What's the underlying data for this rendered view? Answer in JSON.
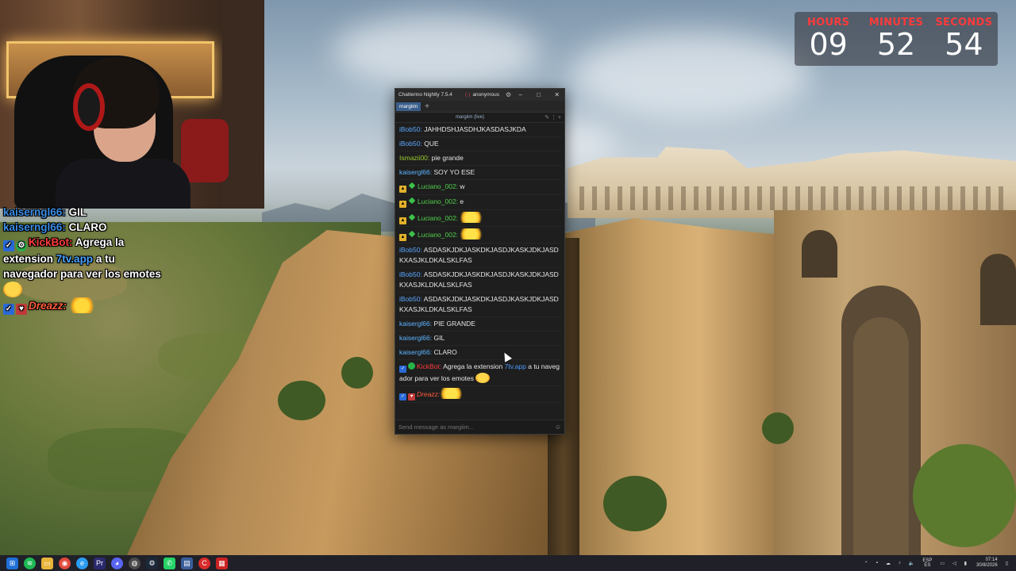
{
  "timer": {
    "hours_label": "HOURS",
    "hours": "09",
    "minutes_label": "MINUTES",
    "minutes": "52",
    "seconds_label": "SECONDS",
    "seconds": "54"
  },
  "overlay_chat": {
    "line1_user": "kaiserngl66:",
    "line1_text": "GIL",
    "line2_user": "kaiserngl66:",
    "line2_text": "CLARO",
    "line3_user": "KickBot:",
    "line3_text_a": "Agrega la extension",
    "line3_link": "7tv.app",
    "line3_text_b": "a tu navegador para ver los emotes",
    "line4_user": "Dreazz:"
  },
  "chatterino": {
    "title": "Chatterino Nightly 7.5.4",
    "account": "anonymous",
    "tab": "margiim",
    "add_tab": "+",
    "split_title": "margiim (live)",
    "input_placeholder": "Send message as margiim..."
  },
  "messages": [
    {
      "user": "iBob50:",
      "text": "JAHHDSHJASDHJKASDASJKDA"
    },
    {
      "user": "iBob50:",
      "text": "QUE"
    },
    {
      "user": "Ismazii00:",
      "text": "pie grande"
    },
    {
      "user": "kaisergl66:",
      "text": "SOY YO ESE"
    },
    {
      "user": "Luciano_002:",
      "text": "w"
    },
    {
      "user": "Luciano_002:",
      "text": "e"
    },
    {
      "user": "Luciano_002:",
      "text": ""
    },
    {
      "user": "Luciano_002:",
      "text": ""
    },
    {
      "user": "iBob50:",
      "text": "ASDASKJDKJASKDKJASDJKASKJDKJASDKXASJKLDKALSKLFAS"
    },
    {
      "user": "iBob50:",
      "text": "ASDASKJDKJASKDKJASDJKASKJDKJASDKXASJKLDKALSKLFAS"
    },
    {
      "user": "iBob50:",
      "text": "ASDASKJDKJASKDKJASDJKASKJDKJASDKXASJKLDKALSKLFAS"
    },
    {
      "user": "kaisergl66:",
      "text": "PIE GRANDE"
    },
    {
      "user": "kaisergl66:",
      "text": "GIL"
    },
    {
      "user": "kaisergl66:",
      "text": "CLARO"
    },
    {
      "user": "KickBot:",
      "text": "Agrega la extension",
      "link": "7tv.app",
      "text_b": "a tu navegador para ver los emotes"
    },
    {
      "user": "Dreazz:",
      "text": ""
    }
  ],
  "taskbar": {
    "lang_1": "ESP",
    "lang_2": "ES",
    "time": "07:14",
    "date": "30/8/2026"
  },
  "colors": {
    "timer_label": "#ff3a3a",
    "chat_username_blue": "#5aa6ff",
    "chat_username_green": "#4fd04a",
    "bot_red": "#ff3b3b",
    "chatterino_tab": "#3b5f8c"
  }
}
